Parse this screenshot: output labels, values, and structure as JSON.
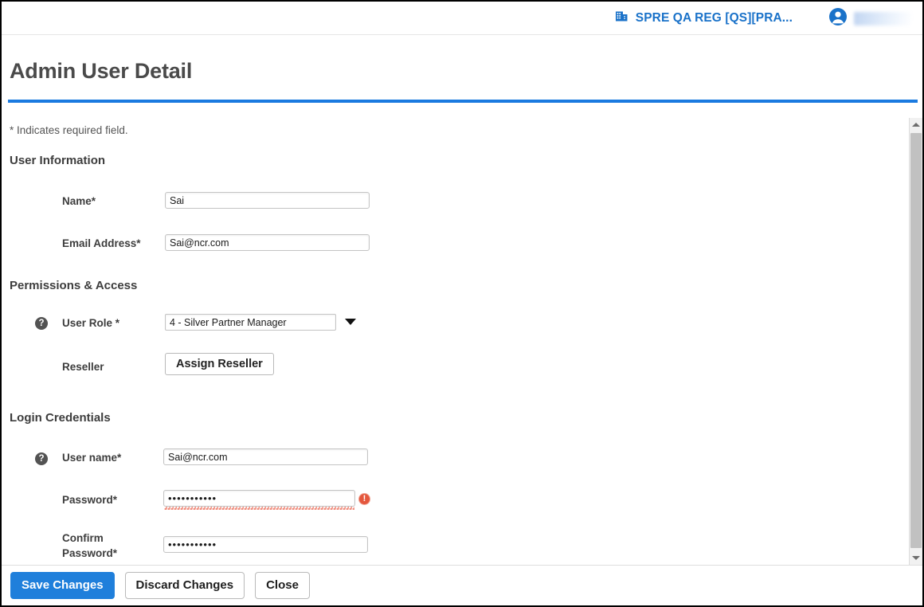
{
  "topbar": {
    "organization_label": "SPRE QA REG [QS][PRA...",
    "organization_icon": "building-icon",
    "user_icon": "user-avatar-icon",
    "user_name": ""
  },
  "page": {
    "title": "Admin User Detail",
    "required_note": "* Indicates required field."
  },
  "sections": {
    "user_information": {
      "heading": "User Information",
      "fields": {
        "name": {
          "label": "Name*",
          "value": "Sai"
        },
        "email": {
          "label": "Email Address*",
          "value": "Sai@ncr.com"
        }
      }
    },
    "permissions_access": {
      "heading": "Permissions & Access",
      "fields": {
        "user_role": {
          "label": "User Role *",
          "value": "4 - Silver Partner Manager",
          "help_icon": "question-mark-icon",
          "caret_icon": "chevron-down-icon"
        },
        "reseller": {
          "label": "Reseller",
          "button_label": "Assign Reseller"
        }
      }
    },
    "login_credentials": {
      "heading": "Login Credentials",
      "fields": {
        "user_name": {
          "label": "User name*",
          "value": "Sai@ncr.com",
          "help_icon": "question-mark-icon"
        },
        "password": {
          "label": "Password*",
          "value": "•••••••••••",
          "error_icon": "error-exclamation-icon"
        },
        "confirm_password": {
          "label": "Confirm Password*",
          "value": "•••••••••••"
        }
      }
    }
  },
  "footer": {
    "save_label": "Save Changes",
    "discard_label": "Discard Changes",
    "close_label": "Close"
  },
  "scrollbar": {
    "up_icon": "scroll-up-arrow-icon",
    "down_icon": "scroll-down-arrow-icon"
  },
  "colors": {
    "accent_blue": "#1a7ae0",
    "link_blue": "#1a72c9",
    "primary_button": "#1f7fdb",
    "error_red": "#e4573d",
    "heading_gray": "#4a4a4a"
  }
}
